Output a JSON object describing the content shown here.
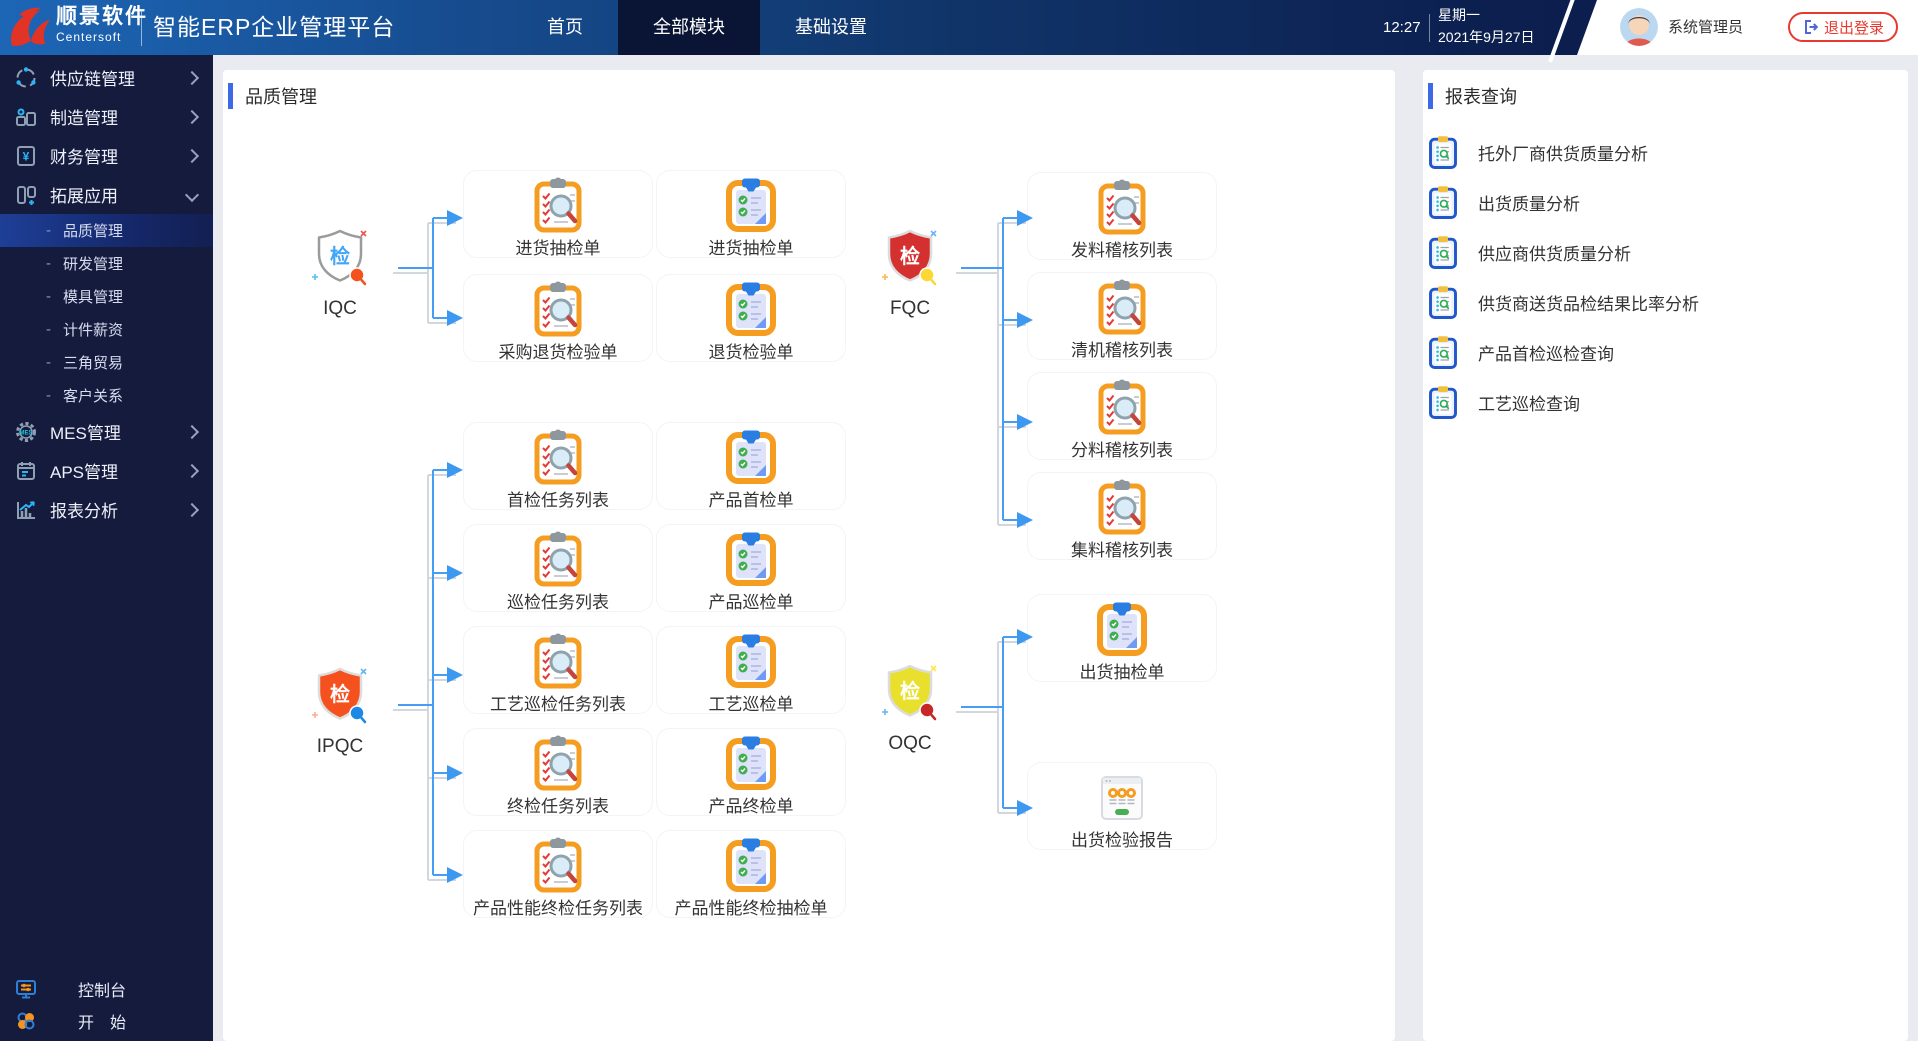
{
  "topbar": {
    "logo_cn": "顺景软件",
    "logo_en": "Centersoft",
    "app_title": "智能ERP企业管理平台",
    "tabs": [
      {
        "label": "首页",
        "active": "false"
      },
      {
        "label": "全部模块",
        "active": "true"
      },
      {
        "label": "基础设置",
        "active": "false"
      }
    ],
    "time": "12:27",
    "weekday": "星期一",
    "date": "2021年9月27日",
    "username": "系统管理员",
    "logout_label": "退出登录"
  },
  "sidebar": {
    "items": [
      {
        "label": "供应链管理",
        "icon": "supply-chain-icon",
        "sym": "#sym-chain",
        "type": "parent",
        "chevron": "right"
      },
      {
        "label": "制造管理",
        "icon": "manufacturing-icon",
        "sym": "#sym-factory",
        "type": "parent",
        "chevron": "right"
      },
      {
        "label": "财务管理",
        "icon": "finance-icon",
        "sym": "#sym-finance",
        "type": "parent",
        "chevron": "right"
      },
      {
        "label": "拓展应用",
        "icon": "extensions-icon",
        "sym": "#sym-extend",
        "type": "parent",
        "chevron": "down"
      },
      {
        "label": "品质管理",
        "type": "sub",
        "dash": "-",
        "active": "true"
      },
      {
        "label": "研发管理",
        "type": "sub",
        "dash": "-"
      },
      {
        "label": "模具管理",
        "type": "sub",
        "dash": "-"
      },
      {
        "label": "计件薪资",
        "type": "sub",
        "dash": "-"
      },
      {
        "label": "三角贸易",
        "type": "sub",
        "dash": "-"
      },
      {
        "label": "客户关系",
        "type": "sub",
        "dash": "-"
      },
      {
        "label": "MES管理",
        "icon": "mes-icon",
        "sym": "#sym-mes",
        "type": "parent",
        "chevron": "right"
      },
      {
        "label": "APS管理",
        "icon": "aps-icon",
        "sym": "#sym-aps",
        "type": "parent",
        "chevron": "right"
      },
      {
        "label": "报表分析",
        "icon": "report-analysis-icon",
        "sym": "#sym-chart",
        "type": "parent",
        "chevron": "right"
      }
    ],
    "console_label": "控制台",
    "start_label": "开　始"
  },
  "main": {
    "title": "品质管理"
  },
  "flow": {
    "iqc": {
      "label": "IQC",
      "variant": "white",
      "col1": [
        {
          "label": "进货抽检单",
          "icon": "audit-clipboard-icon",
          "sym": "#sym-audit"
        },
        {
          "label": "采购退货检验单",
          "icon": "audit-clipboard-icon",
          "sym": "#sym-audit"
        }
      ],
      "col2": [
        {
          "label": "进货抽检单",
          "icon": "checklist-clipboard-icon",
          "sym": "#sym-check"
        },
        {
          "label": "退货检验单",
          "icon": "checklist-clipboard-icon",
          "sym": "#sym-check"
        }
      ]
    },
    "fqc": {
      "label": "FQC",
      "variant": "red",
      "col": [
        {
          "label": "发料稽核列表",
          "icon": "audit-clipboard-icon",
          "sym": "#sym-audit"
        },
        {
          "label": "清机稽核列表",
          "icon": "audit-clipboard-icon",
          "sym": "#sym-audit"
        },
        {
          "label": "分料稽核列表",
          "icon": "audit-clipboard-icon",
          "sym": "#sym-audit"
        },
        {
          "label": "集料稽核列表",
          "icon": "audit-clipboard-icon",
          "sym": "#sym-audit"
        }
      ]
    },
    "ipqc": {
      "label": "IPQC",
      "variant": "orange",
      "col1": [
        {
          "label": "首检任务列表",
          "icon": "audit-clipboard-icon",
          "sym": "#sym-audit"
        },
        {
          "label": "巡检任务列表",
          "icon": "audit-clipboard-icon",
          "sym": "#sym-audit"
        },
        {
          "label": "工艺巡检任务列表",
          "icon": "audit-clipboard-icon",
          "sym": "#sym-audit"
        },
        {
          "label": "终检任务列表",
          "icon": "audit-clipboard-icon",
          "sym": "#sym-audit"
        },
        {
          "label": "产品性能终检任务列表",
          "icon": "audit-clipboard-icon",
          "sym": "#sym-audit"
        }
      ],
      "col2": [
        {
          "label": "产品首检单",
          "icon": "checklist-clipboard-icon",
          "sym": "#sym-check"
        },
        {
          "label": "产品巡检单",
          "icon": "checklist-clipboard-icon",
          "sym": "#sym-check"
        },
        {
          "label": "工艺巡检单",
          "icon": "checklist-clipboard-icon",
          "sym": "#sym-check"
        },
        {
          "label": "产品终检单",
          "icon": "checklist-clipboard-icon",
          "sym": "#sym-check"
        },
        {
          "label": "产品性能终检抽检单",
          "icon": "checklist-clipboard-icon",
          "sym": "#sym-check"
        }
      ]
    },
    "oqc": {
      "label": "OQC",
      "variant": "yellow",
      "col": [
        {
          "label": "出货抽检单",
          "icon": "checklist-clipboard-icon",
          "sym": "#sym-check"
        },
        {
          "label": "出货检验报告",
          "icon": "report-card-icon",
          "sym": "#sym-report"
        }
      ]
    }
  },
  "reports": {
    "title": "报表查询",
    "items": [
      {
        "label": "托外厂商供货质量分析",
        "icon": "report-query-icon",
        "sym": "#sym-query"
      },
      {
        "label": "出货质量分析",
        "icon": "report-query-icon",
        "sym": "#sym-query"
      },
      {
        "label": "供应商供货质量分析",
        "icon": "report-query-icon",
        "sym": "#sym-query"
      },
      {
        "label": "供货商送货品检结果比率分析",
        "icon": "report-query-icon",
        "sym": "#sym-query"
      },
      {
        "label": "产品首检巡检查询",
        "icon": "report-query-icon",
        "sym": "#sym-query"
      },
      {
        "label": "工艺巡检查询",
        "icon": "report-query-icon",
        "sym": "#sym-query"
      }
    ]
  },
  "colors": {
    "topbar_blue": "#1d66b6",
    "topbar_navy": "#0b1b45",
    "active_tab": "#0a1535",
    "sidebar_bg": "#141b3d",
    "sidebar_active": "#1e3f97",
    "accent_blue": "#3e68e7",
    "arrow_blue": "#459ef4",
    "clipboard_orange": "#f59d20",
    "shield_red": "#d3302f",
    "shield_orange": "#f4511e",
    "shield_yellow": "#e8e02c",
    "logout_red": "#e8392f"
  }
}
